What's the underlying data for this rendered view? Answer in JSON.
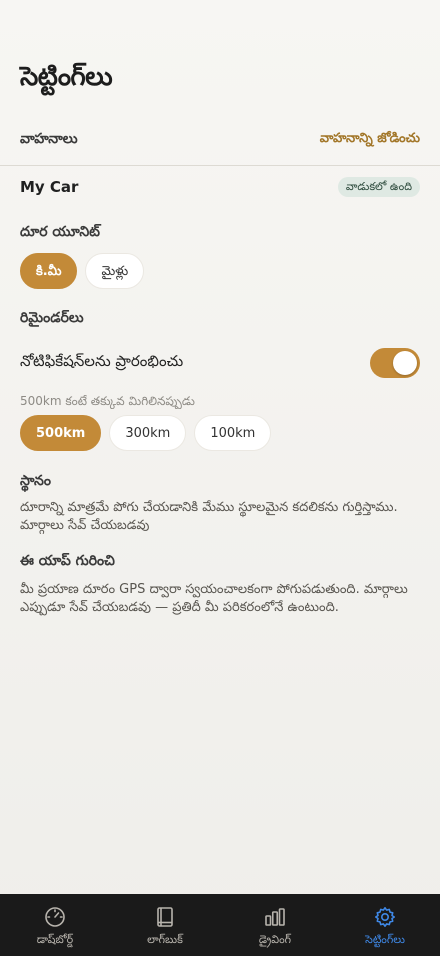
{
  "header": {
    "title": "సెట్టింగ్‌లు"
  },
  "vehicles": {
    "label": "వాహనాలు",
    "add_label": "వాహనాన్ని జోడించు",
    "items": [
      {
        "name": "My Car",
        "badge": "వాడుకలో ఉంది"
      }
    ]
  },
  "distance_unit": {
    "label": "దూర యూనిట్",
    "options": [
      "కి.మీ",
      "మైళ్లు"
    ],
    "selected": "కి.మీ"
  },
  "reminders": {
    "label": "రిమైండర్‌లు",
    "notifications_label": "నోటిఫికేషన్‌లను ప్రారంభించు",
    "notifications_enabled": true,
    "threshold_hint": "500km కంటే తక్కువ మిగిలినప్పుడు",
    "threshold_options": [
      "500km",
      "300km",
      "100km"
    ],
    "threshold_selected": "500km"
  },
  "location": {
    "label": "స్థానం",
    "text": "దూరాన్ని మాత్రమే పోగు చేయడానికి మేము స్థూలమైన కదలికను గుర్తిస్తాము. మార్గాలు సేవ్ చేయబడవు"
  },
  "about": {
    "label": "ఈ యాప్ గురించి",
    "text": "మీ ప్రయాణ దూరం GPS ద్వారా స్వయంచాలకంగా పోగుపడుతుంది. మార్గాలు ఎప్పుడూ సేవ్ చేయబడవు — ప్రతిదీ మీ పరికరంలోనే ఉంటుంది."
  },
  "tabbar": {
    "tabs": [
      {
        "label": "డాష్‌బోర్డ్",
        "icon": "gauge-icon",
        "active": false
      },
      {
        "label": "లాగ్‌బుక్",
        "icon": "book-icon",
        "active": false
      },
      {
        "label": "డ్రైవింగ్",
        "icon": "bar-chart-icon",
        "active": false
      },
      {
        "label": "సెట్టింగ్‌లు",
        "icon": "gear-icon",
        "active": true
      }
    ]
  },
  "colors": {
    "accent": "#c38a38",
    "accent_text": "#a27628",
    "badge_bg": "#dfe9e3",
    "tabbar_bg": "#1a1a1a",
    "tab_active": "#3f89e8"
  }
}
